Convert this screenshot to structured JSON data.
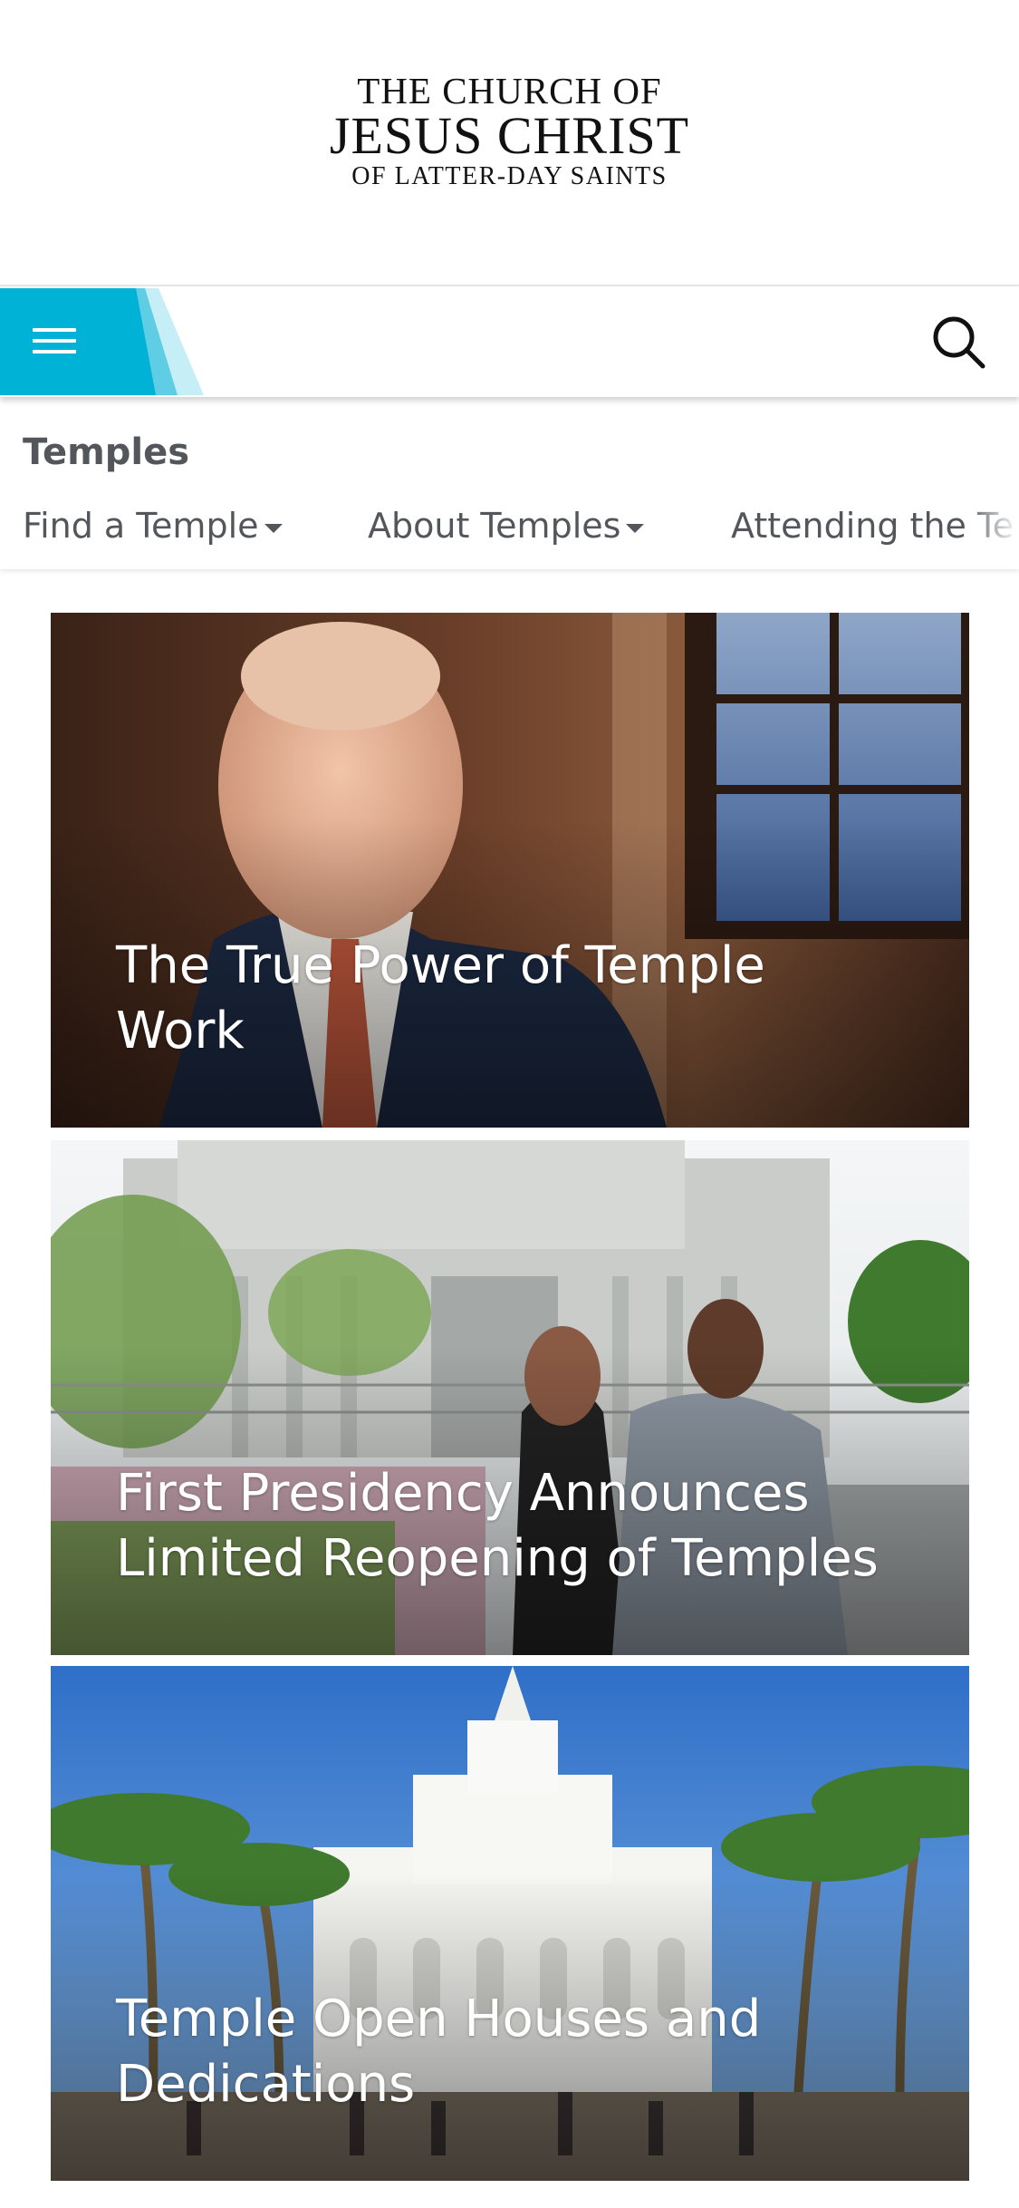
{
  "logo": {
    "line1": "THE CHURCH OF",
    "line2": "JESUS CHRIST",
    "line3": "OF LATTER-DAY SAINTS"
  },
  "navbar": {
    "menu_icon": "hamburger-menu-icon",
    "search_icon": "search-icon",
    "accent_color": "#00b2d6"
  },
  "subnav": {
    "section_title": "Temples",
    "items": [
      {
        "label": "Find a Temple",
        "icon": "caret-down-icon"
      },
      {
        "label": "About Temples",
        "icon": "caret-down-icon"
      },
      {
        "label": "Attending the Te"
      }
    ]
  },
  "cards": [
    {
      "title": "The True Power of Temple Work"
    },
    {
      "title": "First Presidency Announces Limited Reopening of Temples"
    },
    {
      "title": "Temple Open Houses and Dedications"
    }
  ]
}
